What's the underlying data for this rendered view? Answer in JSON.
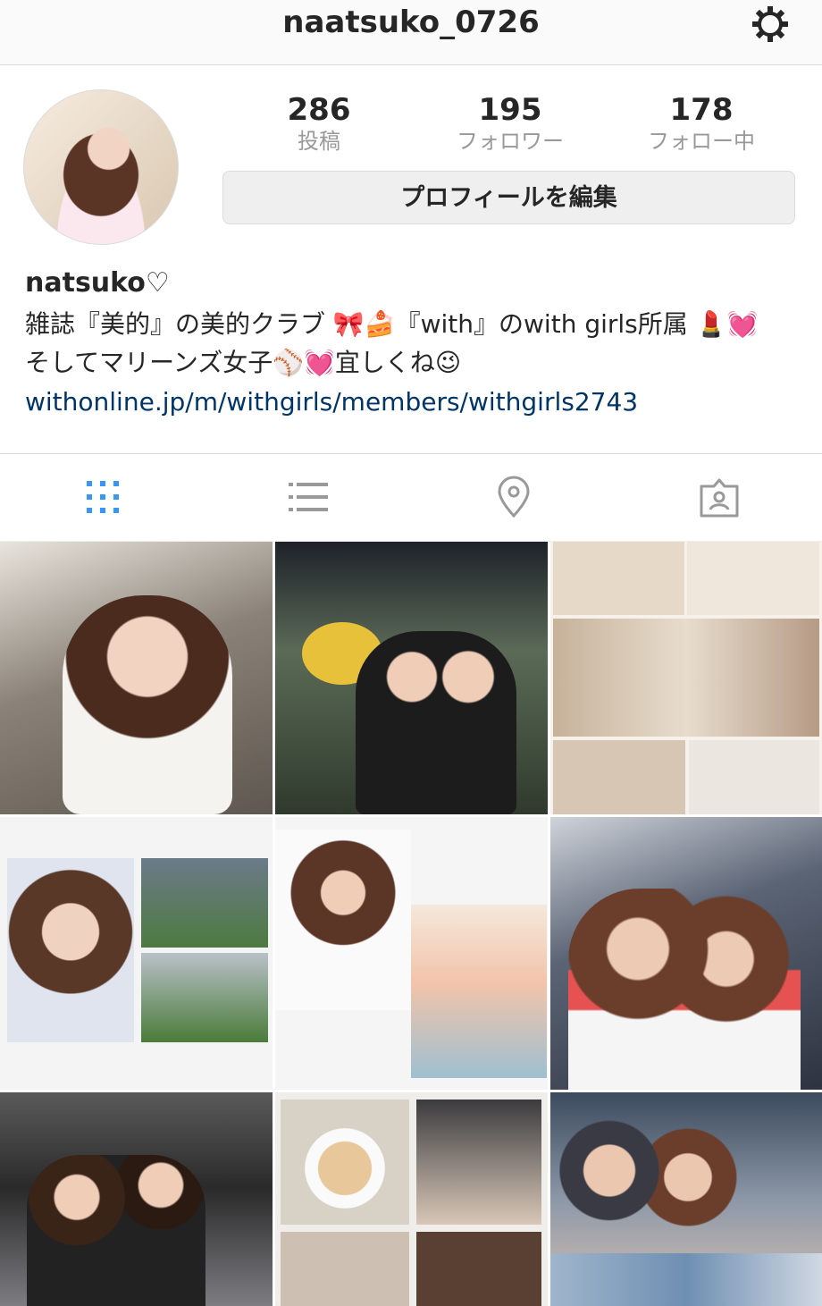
{
  "header": {
    "username": "naatsuko_0726"
  },
  "profile": {
    "stats": [
      {
        "count": "286",
        "label": "投稿"
      },
      {
        "count": "195",
        "label": "フォロワー"
      },
      {
        "count": "178",
        "label": "フォロー中"
      }
    ],
    "edit_label": "プロフィールを編集",
    "display_name": "natsuko♡",
    "bio_line1": "雑誌『美的』の美的クラブ 🎀🍰『with』のwith girls所属 💄💓",
    "bio_line2": "そしてマリーンズ女子⚾💓宜しくね😉",
    "website": "withonline.jp/m/withgirls/members/withgirls2743"
  },
  "tabs": [
    {
      "icon": "grid-icon",
      "active": true
    },
    {
      "icon": "list-icon",
      "active": false
    },
    {
      "icon": "location-pin-icon",
      "active": false
    },
    {
      "icon": "tagged-icon",
      "active": false
    }
  ],
  "colors": {
    "link": "#003569",
    "active_tab": "#3897f0",
    "inactive_tab": "#999999"
  },
  "posts": [
    {
      "tone": [
        "#8c8a86",
        "#c9b8a6"
      ]
    },
    {
      "tone": [
        "#2f3a2c",
        "#6b7760"
      ]
    },
    {
      "tone": [
        "#d9cbbd",
        "#a58f7c"
      ]
    },
    {
      "tone": [
        "#f4f4f4",
        "#e8e2dc"
      ]
    },
    {
      "tone": [
        "#4d5566",
        "#bcb7b4"
      ]
    },
    {
      "tone": [
        "#2a2a2a",
        "#7d7d82"
      ]
    },
    {
      "tone": [
        "#efeeea",
        "#d1c4b6"
      ]
    },
    {
      "tone": [
        "#566a7d",
        "#caa695"
      ]
    }
  ]
}
